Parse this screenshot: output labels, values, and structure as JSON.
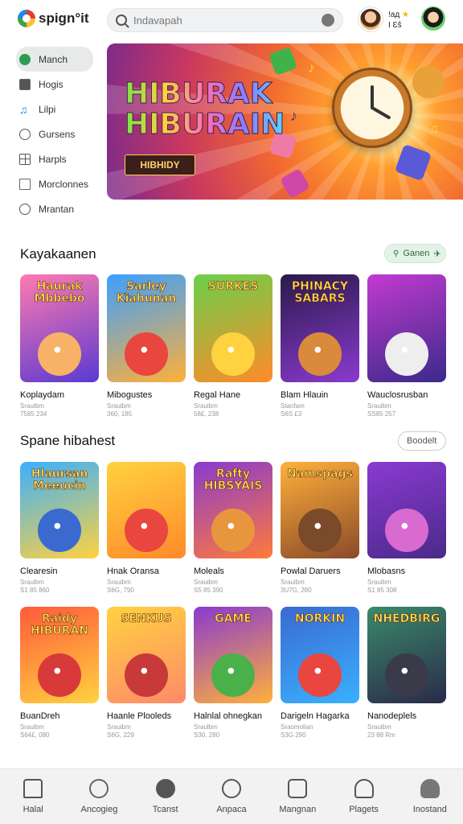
{
  "header": {
    "logo_text": "spign°it",
    "search_placeholder": "Indavapah",
    "user_line1": "!aд",
    "user_line2": "I Ɛš"
  },
  "sidebar": {
    "items": [
      {
        "label": "Manch",
        "icon": "home-icon",
        "active": true
      },
      {
        "label": "Hogis",
        "icon": "document-icon"
      },
      {
        "label": "Lilpi",
        "icon": "music-note-icon"
      },
      {
        "label": "Gursens",
        "icon": "user-icon"
      },
      {
        "label": "Harpls",
        "icon": "grid-icon"
      },
      {
        "label": "Morclonnes",
        "icon": "box-icon"
      },
      {
        "label": "Mrantan",
        "icon": "search-icon"
      }
    ]
  },
  "banner": {
    "title_line1": "HIBURAK",
    "title_line2": "HIBURAIN",
    "cta": "HIBHIDY"
  },
  "section1": {
    "title": "Kayakaanen",
    "chip": "Ganen",
    "cards": [
      {
        "thumb_title": "Haurak Mbbebo",
        "name": "Koplaydam",
        "sub1": "Srauibm",
        "sub2": "7585 234",
        "color1": "#ff7ab0",
        "color2": "#5a3ad0",
        "char": "#f7b267"
      },
      {
        "thumb_title": "Sarley Kiahunan",
        "name": "Mibogustes",
        "sub1": "Srauibm",
        "sub2": "360, 185",
        "color1": "#3aa0ff",
        "color2": "#ffb03a",
        "char": "#e8463e"
      },
      {
        "thumb_title": "SURKES",
        "name": "Regal Hane",
        "sub1": "Srauibm",
        "sub2": "58£, 238",
        "color1": "#6ad04a",
        "color2": "#ff8a2a",
        "char": "#ffd23f"
      },
      {
        "thumb_title": "PHINACY SABARS",
        "name": "Blam Hlauin",
        "sub1": "Stanfam",
        "sub2": "S6S £3",
        "color1": "#2a1a4a",
        "color2": "#8a3ad0",
        "char": "#d98a3a"
      },
      {
        "thumb_title": "",
        "name": "Wauclosrusban",
        "sub1": "Srauibm",
        "sub2": "SS85 257",
        "color1": "#c23ad0",
        "color2": "#3a2a8a",
        "char": "#eeeeee"
      }
    ]
  },
  "section2": {
    "title": "Spane hibahest",
    "chip": "Boodelt",
    "cards_row1": [
      {
        "thumb_title": "Hlaursan Meeucin",
        "name": "Clearesin",
        "sub1": "Srauibm",
        "sub2": "S1 85 860",
        "color1": "#3ab0ff",
        "color2": "#ffd23f",
        "char": "#3a6ad0"
      },
      {
        "thumb_title": "",
        "name": "Hnak Oransa",
        "sub1": "Srauibm",
        "sub2": "S6G, 790",
        "color1": "#ffd23f",
        "color2": "#ff8a2a",
        "char": "#e8463e"
      },
      {
        "thumb_title": "Rafty HIBSYAIS",
        "name": "Moleals",
        "sub1": "Srauibm",
        "sub2": "S5 85 390",
        "color1": "#8a3ad0",
        "color2": "#ff7a3a",
        "char": "#e8963e"
      },
      {
        "thumb_title": "Namspags",
        "name": "Powlal Daruers",
        "sub1": "Srauibm",
        "sub2": "3U7G, 280",
        "color1": "#ffb03a",
        "color2": "#8a4a2a",
        "char": "#7a4a2a"
      },
      {
        "thumb_title": "",
        "name": "Mlobasns",
        "sub1": "Srauibm",
        "sub2": "S1 85 308",
        "color1": "#8a3ad0",
        "color2": "#4a2a8a",
        "char": "#d96ad0"
      }
    ],
    "cards_row2": [
      {
        "thumb_title": "Raidy HIBURAN",
        "name": "BuanDreh",
        "sub1": "Srauibm",
        "sub2": "S64£, 080",
        "color1": "#ff5a3a",
        "color2": "#ffd23f",
        "char": "#d83a3a"
      },
      {
        "thumb_title": "SENKUS",
        "name": "Haanle Plooleds",
        "sub1": "Srauibm",
        "sub2": "S6G, 229",
        "color1": "#ffd23f",
        "color2": "#ff8a6a",
        "char": "#c83a3a"
      },
      {
        "thumb_title": "GAME",
        "name": "Halnlal ohnegkan",
        "sub1": "Sraulbm",
        "sub2": "S30, 280",
        "color1": "#8a3ad0",
        "color2": "#ffb03a",
        "char": "#4ab04a"
      },
      {
        "thumb_title": "NORKIN",
        "name": "Darigeln Hagarka",
        "sub1": "Sraomolian",
        "sub2": "S3G 290",
        "color1": "#3a6ad0",
        "color2": "#3ab0ff",
        "char": "#e8463e"
      },
      {
        "thumb_title": "NHEDBIRG",
        "name": "Nanodeplels",
        "sub1": "Srauibm",
        "sub2": "23 88 Rm",
        "color1": "#3a8a6a",
        "color2": "#2a2a4a",
        "char": "#3a3a4a"
      }
    ]
  },
  "bottom_nav": [
    {
      "label": "Halal",
      "icon": "home-icon"
    },
    {
      "label": "Ancogieg",
      "icon": "spiral-icon"
    },
    {
      "label": "Tcanst",
      "icon": "circle-icon"
    },
    {
      "label": "Anpaca",
      "icon": "info-icon"
    },
    {
      "label": "Mangnan",
      "icon": "dice-icon"
    },
    {
      "label": "Plagets",
      "icon": "user-star-icon"
    },
    {
      "label": "Inostand",
      "icon": "profile-icon"
    }
  ]
}
